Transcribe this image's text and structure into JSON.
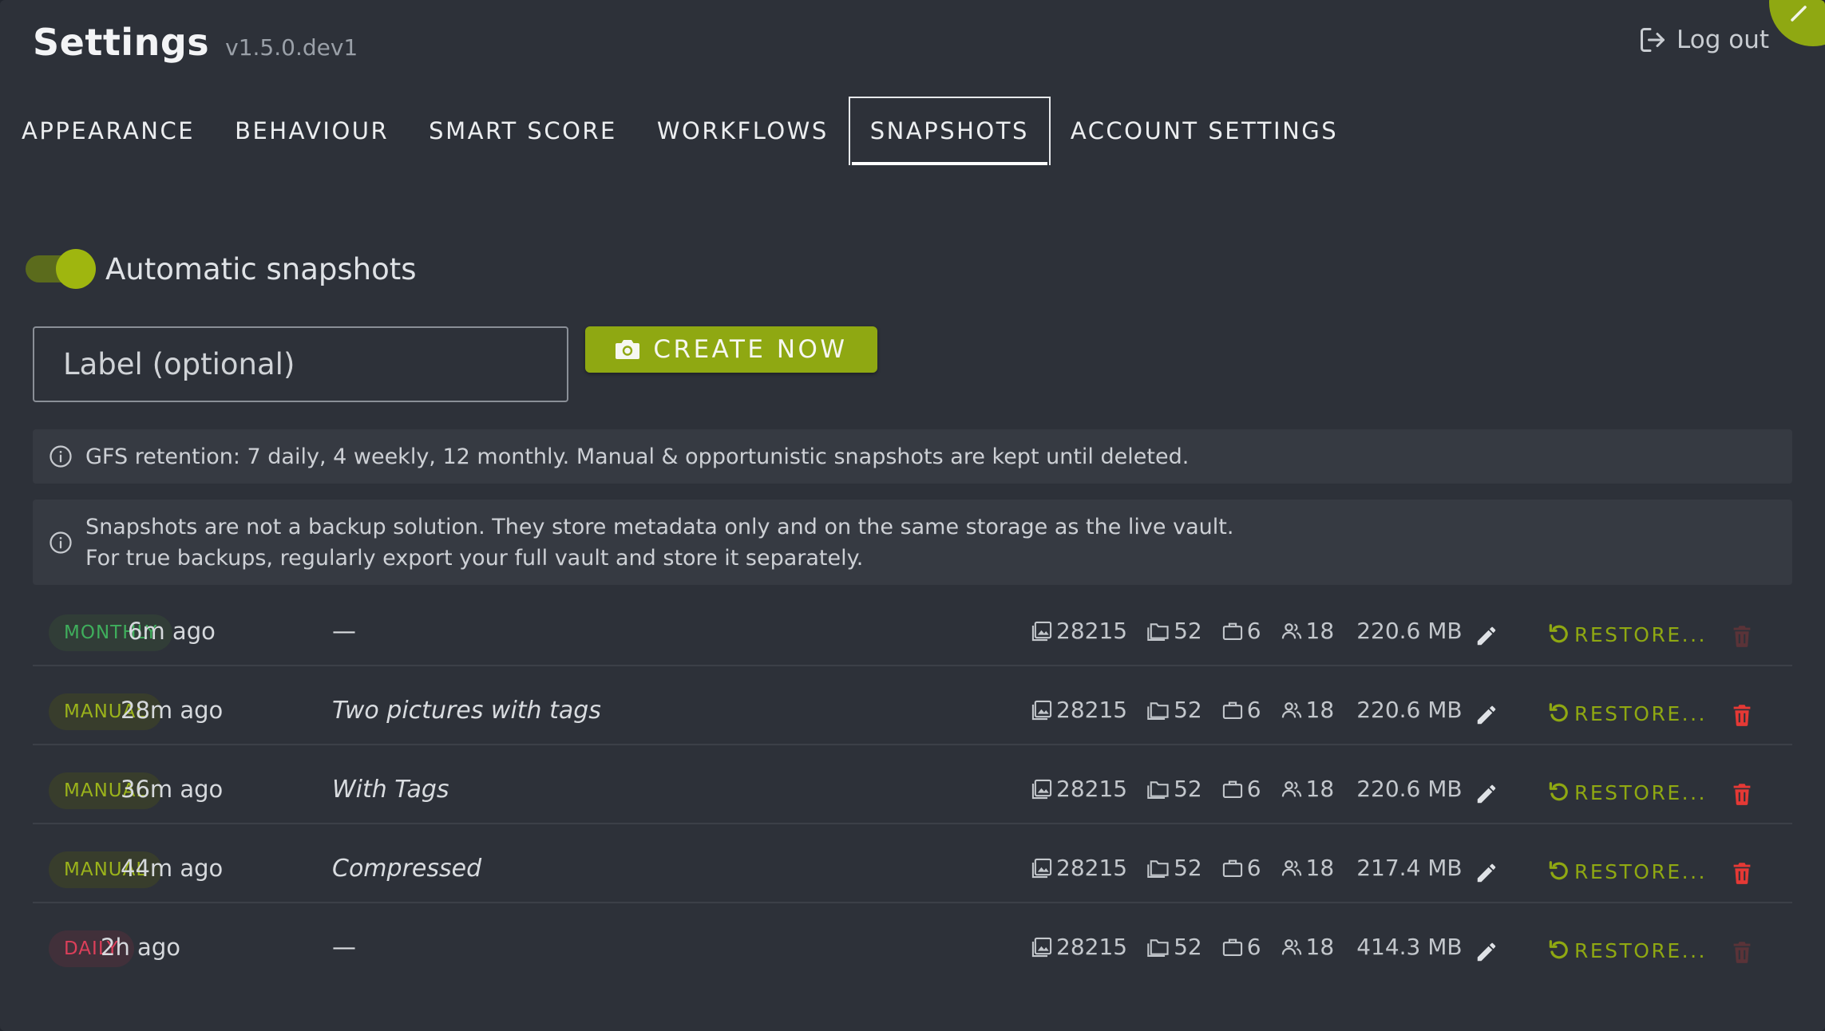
{
  "header": {
    "title": "Settings",
    "version": "v1.5.0.dev1",
    "logout_label": "Log out"
  },
  "tabs": [
    {
      "label": "APPEARANCE",
      "active": false
    },
    {
      "label": "BEHAVIOUR",
      "active": false
    },
    {
      "label": "SMART SCORE",
      "active": false
    },
    {
      "label": "WORKFLOWS",
      "active": false
    },
    {
      "label": "SNAPSHOTS",
      "active": true
    },
    {
      "label": "ACCOUNT SETTINGS",
      "active": false
    }
  ],
  "auto_snapshots": {
    "label": "Automatic snapshots",
    "enabled": true
  },
  "create": {
    "input_placeholder": "Label (optional)",
    "input_value": "",
    "button_label": "CREATE NOW"
  },
  "info": {
    "retention": "GFS retention: 7 daily, 4 weekly, 12 monthly. Manual & opportunistic snapshots are kept until deleted.",
    "warning_line1": "Snapshots are not a backup solution. They store metadata only and on the same storage as the live vault.",
    "warning_line2": "For true backups, regularly export your full vault and store it separately."
  },
  "restore_label": "RESTORE...",
  "snapshots": [
    {
      "type": "MONTHLY",
      "age": "6m ago",
      "label": "—",
      "images": "28215",
      "folders": "52",
      "projects": "6",
      "people": "18",
      "size": "220.6 MB",
      "deletable": false
    },
    {
      "type": "MANUAL",
      "age": "28m ago",
      "label": "Two pictures with tags",
      "images": "28215",
      "folders": "52",
      "projects": "6",
      "people": "18",
      "size": "220.6 MB",
      "deletable": true
    },
    {
      "type": "MANUAL",
      "age": "36m ago",
      "label": "With Tags",
      "images": "28215",
      "folders": "52",
      "projects": "6",
      "people": "18",
      "size": "220.6 MB",
      "deletable": true
    },
    {
      "type": "MANUAL",
      "age": "44m ago",
      "label": "Compressed",
      "images": "28215",
      "folders": "52",
      "projects": "6",
      "people": "18",
      "size": "217.4 MB",
      "deletable": true
    },
    {
      "type": "DAILY",
      "age": "2h ago",
      "label": "—",
      "images": "28215",
      "folders": "52",
      "projects": "6",
      "people": "18",
      "size": "414.3 MB",
      "deletable": false
    }
  ],
  "colors": {
    "accent": "#8fa812",
    "background": "#2d3139",
    "monthly": "#3fae5c",
    "manual": "#9bb31b",
    "daily": "#dc3f5a",
    "delete_active": "#e53935",
    "delete_disabled": "#5a3338"
  },
  "icons": {
    "logout": "logout-icon",
    "camera": "camera-icon",
    "info": "info-icon",
    "images": "image-icon",
    "folders": "folder-icon",
    "projects": "briefcase-icon",
    "people": "people-icon",
    "edit": "pencil-icon",
    "restore": "restore-icon",
    "delete": "trash-icon",
    "close": "close-icon"
  }
}
